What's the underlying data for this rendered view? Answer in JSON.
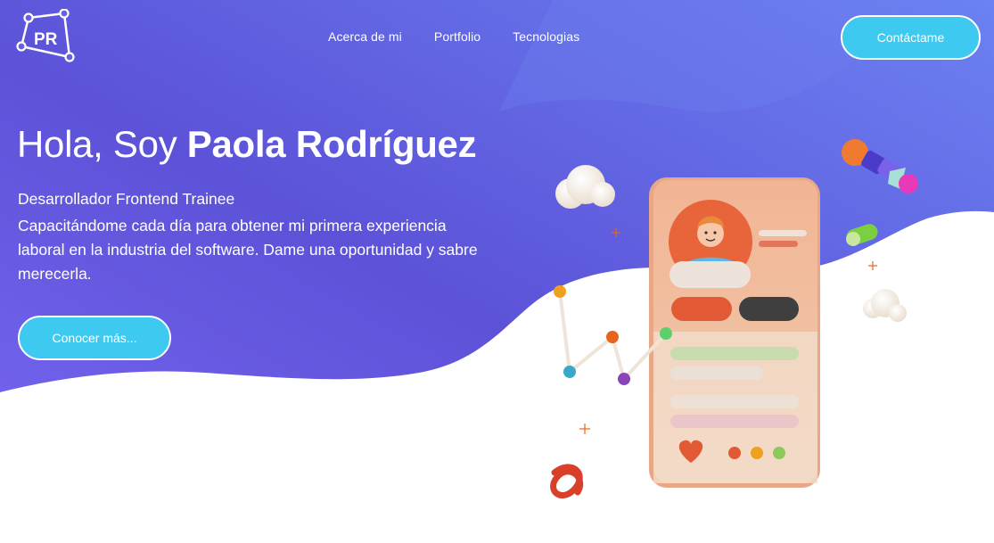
{
  "brand": {
    "logo_text": "PR"
  },
  "nav": {
    "items": [
      {
        "label": "Acerca de mi"
      },
      {
        "label": "Portfolio"
      },
      {
        "label": "Tecnologias"
      }
    ],
    "contact_label": "Contáctame"
  },
  "hero": {
    "greeting": "Hola, Soy ",
    "name": "Paola Rodríguez",
    "role": "Desarrollador Frontend Trainee",
    "description": "Capacitándome cada día para obtener mi primera experiencia laboral en la industria del software. Dame una oportunidad y sabre merecerla.",
    "cta_label": "Conocer más..."
  },
  "colors": {
    "gradient_start": "#6a5fe0",
    "gradient_end": "#6b7cf0",
    "accent": "#3ec9f0",
    "text": "#ffffff"
  },
  "illustration": {
    "name": "profile-phone-3d-illustration"
  }
}
